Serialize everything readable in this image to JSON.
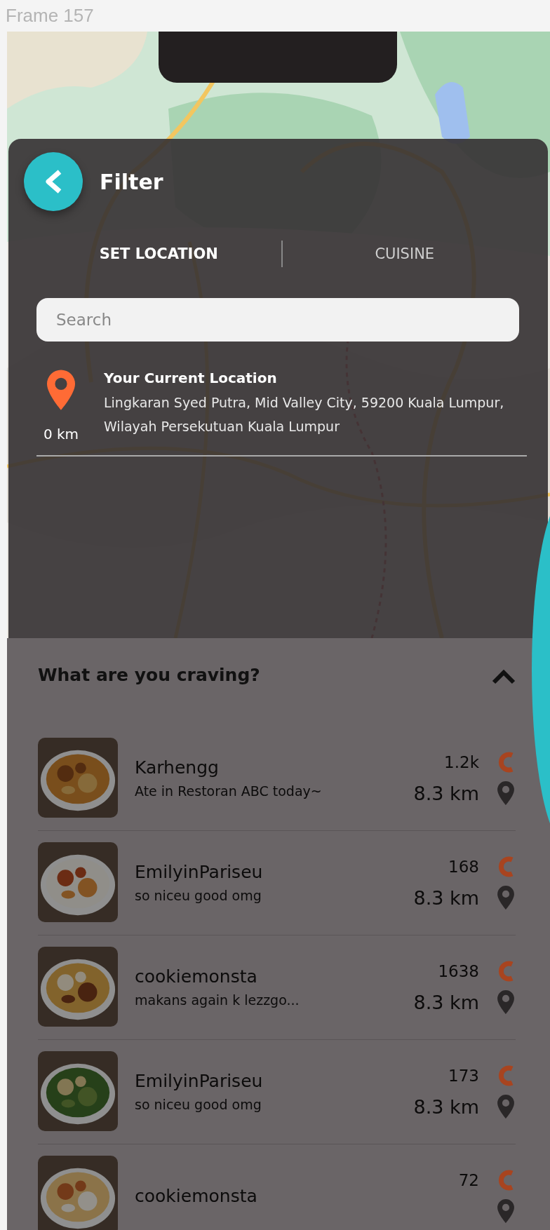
{
  "frame_label": "Frame 157",
  "filter": {
    "title": "Filter",
    "tabs": [
      {
        "label": "SET LOCATION",
        "selected": true
      },
      {
        "label": "CUISINE",
        "selected": false
      }
    ],
    "search": {
      "placeholder": "Search"
    },
    "current_location": {
      "title": "Your Current Location",
      "address": "Lingkaran Syed Putra, Mid Valley City, 59200 Kuala Lumpur, Wilayah Persekutuan Kuala Lumpur",
      "distance": "0 km"
    }
  },
  "feed": {
    "title": "What are you craving?",
    "expanded": true,
    "posts": [
      {
        "name": "Karhengg",
        "caption": "Ate in Restoran ABC today~",
        "count": "1.2k",
        "distance": "8.3 km"
      },
      {
        "name": "EmilyinPariseu",
        "caption": "so niceu good omg",
        "count": "168",
        "distance": "8.3 km"
      },
      {
        "name": "cookiemonsta",
        "caption": "makans again k lezzgo...",
        "count": "1638",
        "distance": "8.3 km"
      },
      {
        "name": "EmilyinPariseu",
        "caption": "so niceu good omg",
        "count": "173",
        "distance": "8.3 km"
      },
      {
        "name": "cookiemonsta",
        "count": "72"
      }
    ]
  }
}
